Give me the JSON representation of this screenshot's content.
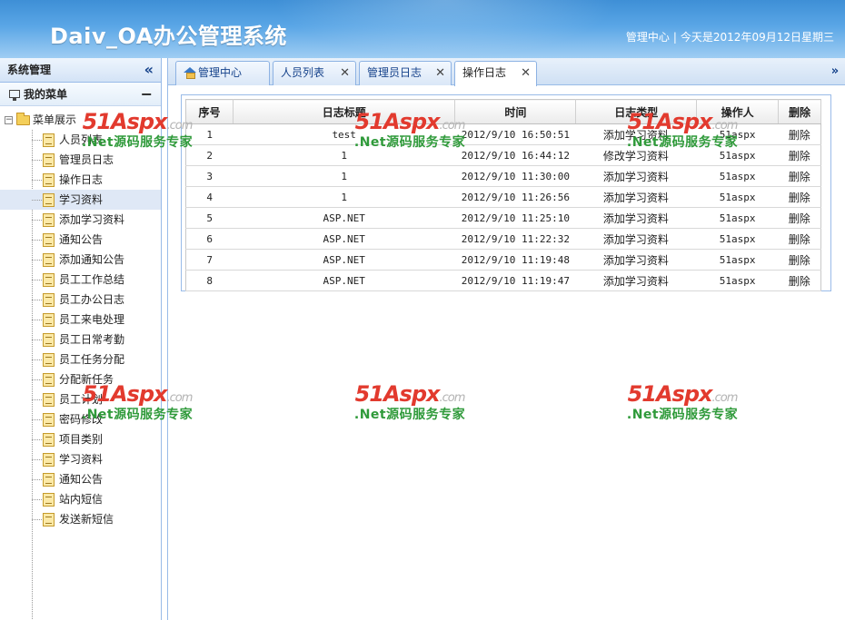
{
  "header": {
    "logo": "Daiv_OA办公管理系统",
    "admin_link": "管理中心",
    "date_text": "今天是2012年09月12日星期三"
  },
  "sidebar": {
    "title": "系统管理",
    "my_menu": "我的菜单",
    "tree_root": "菜单展示",
    "items": [
      "人员列表",
      "管理员日志",
      "操作日志",
      "学习资料",
      "添加学习资料",
      "通知公告",
      "添加通知公告",
      "员工工作总结",
      "员工办公日志",
      "员工来电处理",
      "员工日常考勤",
      "员工任务分配",
      "分配新任务",
      "员工计划",
      "密码修改",
      "项目类别",
      "学习资料",
      "通知公告",
      "站内短信",
      "发送新短信"
    ],
    "selected_index": 3
  },
  "tabs": [
    {
      "label": "管理中心",
      "closable": false
    },
    {
      "label": "人员列表",
      "closable": true
    },
    {
      "label": "管理员日志",
      "closable": true
    },
    {
      "label": "操作日志",
      "closable": true,
      "active": true
    }
  ],
  "table": {
    "headers": [
      "序号",
      "日志标题",
      "时间",
      "日志类型",
      "操作人",
      "删除"
    ],
    "rows": [
      [
        "1",
        "test",
        "2012/9/10 16:50:51",
        "添加学习资料",
        "51aspx",
        "删除"
      ],
      [
        "2",
        "1",
        "2012/9/10 16:44:12",
        "修改学习资料",
        "51aspx",
        "删除"
      ],
      [
        "3",
        "1",
        "2012/9/10 11:30:00",
        "添加学习资料",
        "51aspx",
        "删除"
      ],
      [
        "4",
        "1",
        "2012/9/10 11:26:56",
        "添加学习资料",
        "51aspx",
        "删除"
      ],
      [
        "5",
        "ASP.NET",
        "2012/9/10 11:25:10",
        "添加学习资料",
        "51aspx",
        "删除"
      ],
      [
        "6",
        "ASP.NET",
        "2012/9/10 11:22:32",
        "添加学习资料",
        "51aspx",
        "删除"
      ],
      [
        "7",
        "ASP.NET",
        "2012/9/10 11:19:48",
        "添加学习资料",
        "51aspx",
        "删除"
      ],
      [
        "8",
        "ASP.NET",
        "2012/9/10 11:19:47",
        "添加学习资料",
        "51aspx",
        "删除"
      ]
    ]
  },
  "watermark": {
    "brand": "51Aspx",
    "domain": ".com",
    "slogan": ".Net源码服务专家"
  },
  "colors": {
    "header_blue": "#3e8fd6",
    "border_blue": "#99bbe8",
    "watermark_red": "#e23a2e",
    "watermark_green": "#2f9a3a"
  }
}
